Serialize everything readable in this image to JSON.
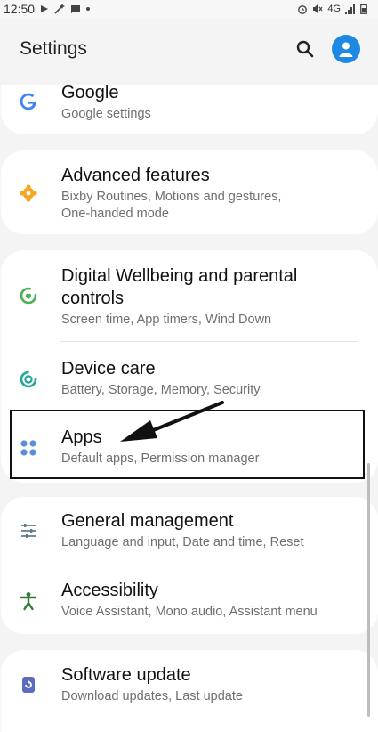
{
  "status_bar": {
    "time": "12:50",
    "right_text": "4G"
  },
  "header": {
    "title": "Settings"
  },
  "items": [
    {
      "title": "Google",
      "subtitle": "Google settings",
      "icon": "google-icon",
      "color": "#4285f4"
    },
    {
      "title": "Advanced features",
      "subtitle": "Bixby Routines, Motions and gestures, One-handed mode",
      "icon": "puzzle-icon",
      "color": "#f5a623"
    },
    {
      "title": "Digital Wellbeing and parental controls",
      "subtitle": "Screen time, App timers, Wind Down",
      "icon": "wellbeing-icon",
      "color": "#4caf50"
    },
    {
      "title": "Device care",
      "subtitle": "Battery, Storage, Memory, Security",
      "icon": "device-care-icon",
      "color": "#26a69a"
    },
    {
      "title": "Apps",
      "subtitle": "Default apps, Permission manager",
      "icon": "apps-icon",
      "color": "#5b8fd6"
    },
    {
      "title": "General management",
      "subtitle": "Language and input, Date and time, Reset",
      "icon": "sliders-icon",
      "color": "#607d8b"
    },
    {
      "title": "Accessibility",
      "subtitle": "Voice Assistant, Mono audio, Assistant menu",
      "icon": "accessibility-icon",
      "color": "#2e7d32"
    },
    {
      "title": "Software update",
      "subtitle": "Download updates, Last update",
      "icon": "software-update-icon",
      "color": "#5c6bc0"
    }
  ],
  "annotation": {
    "highlighted_item": "Apps",
    "arrow_color": "#111111"
  }
}
